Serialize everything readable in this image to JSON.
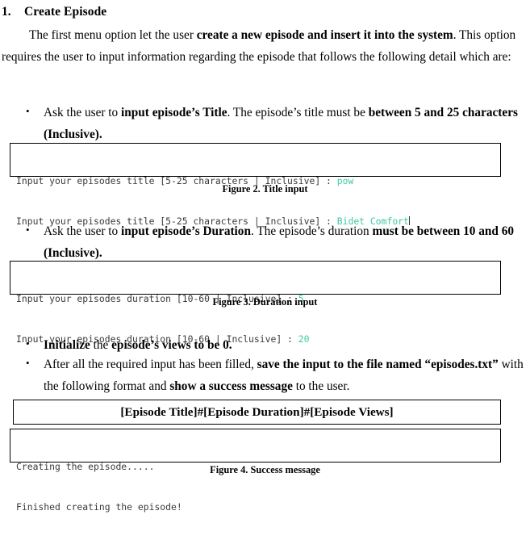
{
  "document": {
    "heading": {
      "number": "1.",
      "title": "Create Episode"
    },
    "intro": {
      "part1": "The first menu option let the user ",
      "bold1": "create a new episode and insert it into the system",
      "part2": ". This option requires the user to input information regarding the episode that follows the following detail which are:"
    },
    "bullets": {
      "title_input": {
        "marker": "•",
        "part1": "Ask the user to ",
        "bold1": "input episode’s Title",
        "part2": ". The episode’s title must be ",
        "bold2": "between 5 and 25 characters (Inclusive)."
      },
      "duration_input": {
        "marker": "•",
        "part1": "Ask the user to ",
        "bold1": "input episode’s Duration",
        "part2": ". The episode’s duration ",
        "bold2": "must be between 10 and 60 (Inclusive)."
      },
      "views_init": {
        "marker": "•",
        "bold1": "Initialize",
        "part1": " the ",
        "bold2": "episode’s views to be 0."
      },
      "save_file": {
        "marker": "•",
        "part1": "After all the required input has been filled, ",
        "bold1": "save the input to the file named “episodes.txt”",
        "part2": " with the following format and ",
        "bold2": "show a success message",
        "part3": " to the user."
      }
    },
    "consoles": {
      "title_input": {
        "line1_prompt": "Input your episodes title [5-25 characters | Inclusive] : ",
        "line1_value": "pow",
        "line2_prompt": "Input your episodes title [5-25 characters | Inclusive] : ",
        "line2_value": "Bidet Comfort"
      },
      "duration_input": {
        "line1_prompt": "Input your episodes duration [10-60 | Inclusive] : ",
        "line1_value": "5",
        "line2_prompt": "Input your episodes duration [10-60 | Inclusive] : ",
        "line2_value": "20"
      },
      "success_message": {
        "line1": "Creating the episode.....",
        "line2": "Finished creating the episode!"
      }
    },
    "format_box": {
      "text": "[Episode Title]#[Episode Duration]#[Episode Views]"
    },
    "captions": {
      "figure2": "Figure 2. Title input",
      "figure3": "Figure 3. Duration input",
      "figure4": "Figure 4. Success message"
    },
    "colors": {
      "user_input_green": "#3ec9a3",
      "console_text": "#3a3a3a",
      "border": "#000000"
    }
  }
}
